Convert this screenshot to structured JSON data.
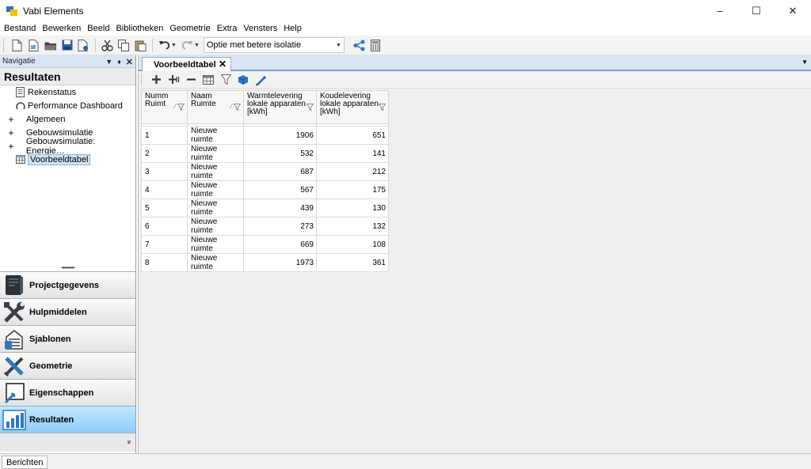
{
  "window": {
    "title": "Vabi Elements"
  },
  "menu": [
    "Bestand",
    "Bewerken",
    "Beeld",
    "Bibliotheken",
    "Geometrie",
    "Extra",
    "Vensters",
    "Help"
  ],
  "toolbar": {
    "variant_value": "Optie met betere isolatie"
  },
  "navigation": {
    "header": "Navigatie",
    "section": "Resultaten",
    "tree": [
      {
        "label": "Rekenstatus",
        "icon": "report-icon",
        "expander": ""
      },
      {
        "label": "Performance Dashboard",
        "icon": "gauge-icon",
        "expander": ""
      },
      {
        "label": "Algemeen",
        "icon": "",
        "expander": "+"
      },
      {
        "label": "Gebouwsimulatie",
        "icon": "",
        "expander": "+"
      },
      {
        "label": "Gebouwsimulatie: Energie…",
        "icon": "",
        "expander": "+"
      },
      {
        "label": "Voorbeeldtabel",
        "icon": "table-icon",
        "expander": ""
      }
    ],
    "buttons": [
      {
        "label": "Projectgegevens",
        "icon": "project-book-icon"
      },
      {
        "label": "Hulpmiddelen",
        "icon": "tools-icon"
      },
      {
        "label": "Sjablonen",
        "icon": "templates-icon"
      },
      {
        "label": "Geometrie",
        "icon": "geometry-icon"
      },
      {
        "label": "Eigenschappen",
        "icon": "properties-icon"
      },
      {
        "label": "Resultaten",
        "icon": "results-chart-icon"
      }
    ],
    "more_glyph": "»"
  },
  "document": {
    "tab_label": "Voorbeeldtabel",
    "table": {
      "columns": [
        {
          "lines": [
            "Numm",
            "Ruimt"
          ]
        },
        {
          "lines": [
            "Naam",
            "Ruimte"
          ]
        },
        {
          "lines": [
            "Warmtelevering",
            "lokale apparaten",
            "[kWh]"
          ]
        },
        {
          "lines": [
            "Koudelevering",
            "lokale apparaten",
            "[kWh]"
          ]
        }
      ],
      "rows": [
        [
          "1",
          "Nieuwe ruimte",
          "1906",
          "651"
        ],
        [
          "2",
          "Nieuwe ruimte",
          "532",
          "141"
        ],
        [
          "3",
          "Nieuwe ruimte",
          "687",
          "212"
        ],
        [
          "4",
          "Nieuwe ruimte",
          "567",
          "175"
        ],
        [
          "5",
          "Nieuwe ruimte",
          "439",
          "130"
        ],
        [
          "6",
          "Nieuwe ruimte",
          "273",
          "132"
        ],
        [
          "7",
          "Nieuwe ruimte",
          "669",
          "108"
        ],
        [
          "8",
          "Nieuwe ruimte",
          "1973",
          "361"
        ]
      ]
    }
  },
  "status": {
    "tab_label": "Berichten"
  },
  "colors": {
    "active_nav": "#9fd4f7",
    "accent_blue": "#2a78c8",
    "panel_header": "#dbe5f1"
  }
}
